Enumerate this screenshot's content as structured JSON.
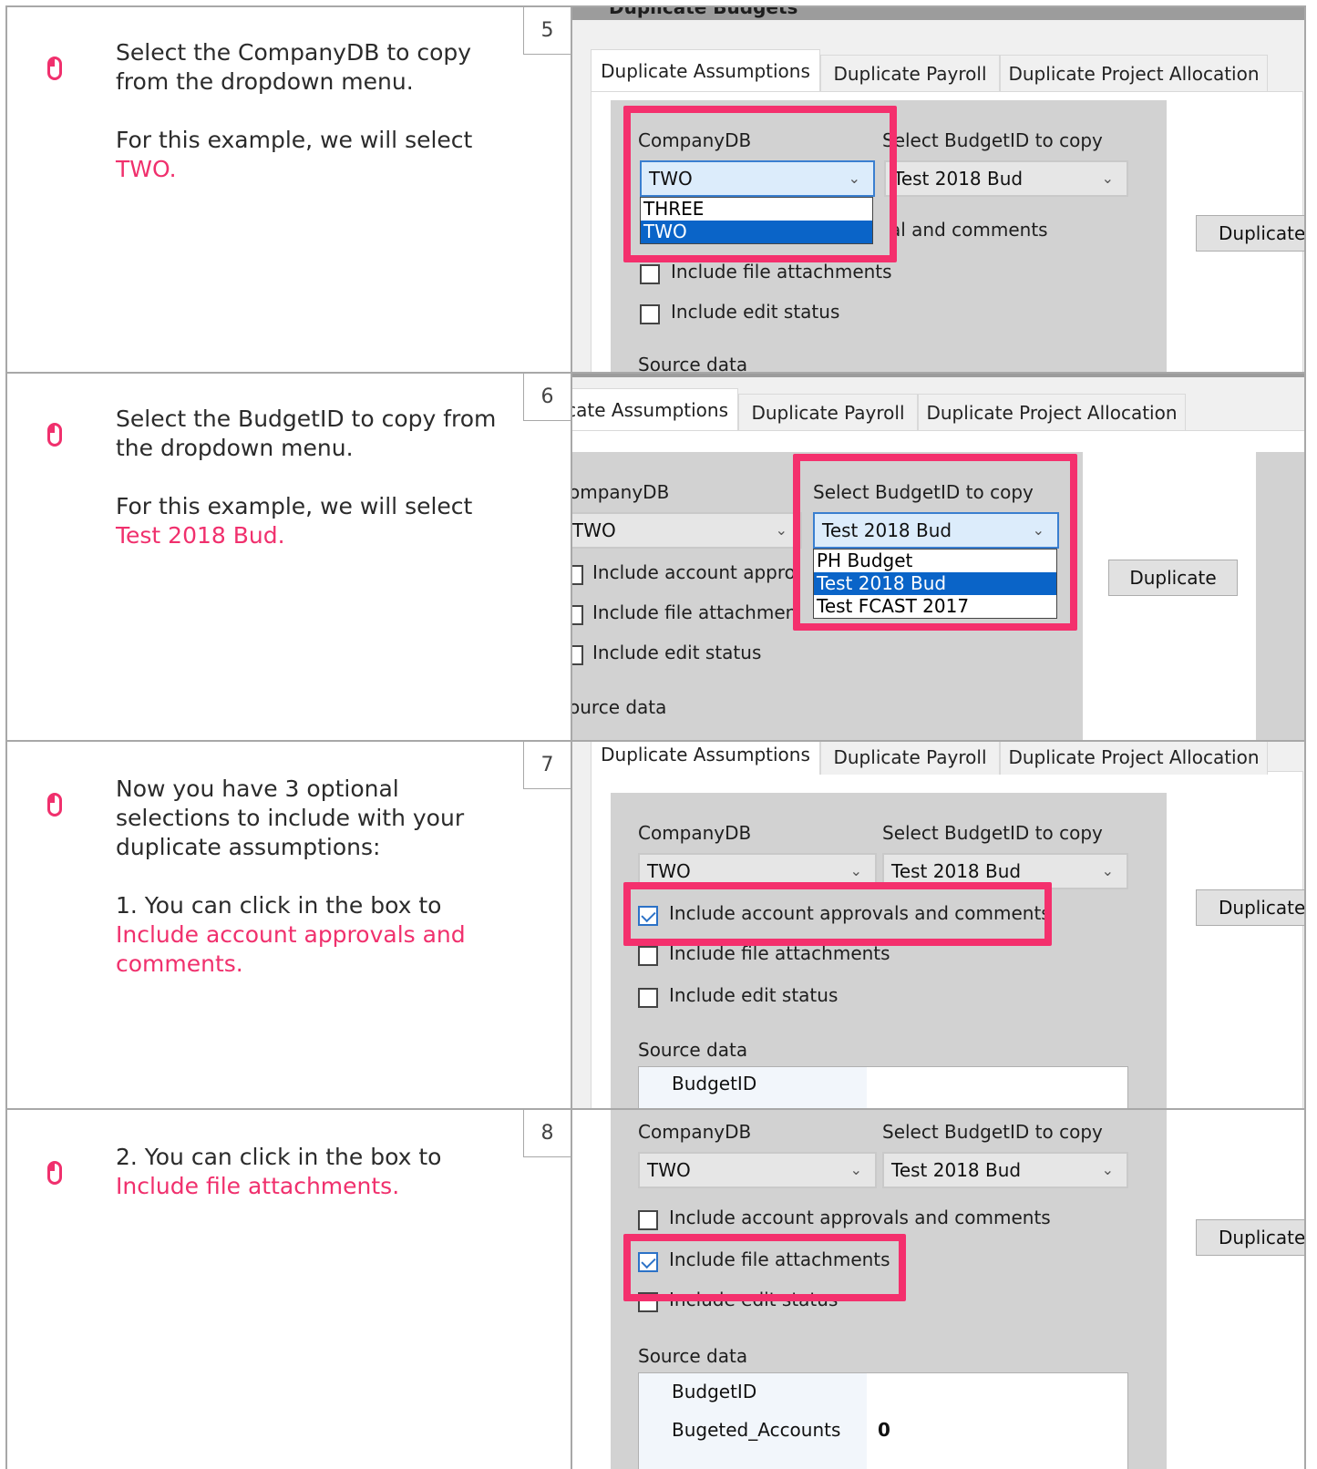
{
  "steps": [
    {
      "number": "5",
      "text1": "Select the CompanyDB to copy from the dropdown menu.",
      "text2_prefix": "For this example, we will select ",
      "text2_highlight": "TWO."
    },
    {
      "number": "6",
      "text1": "Select the BudgetID to copy from the dropdown menu.",
      "text2_prefix": "For this example, we will select ",
      "text2_highlight": "Test 2018 Bud."
    },
    {
      "number": "7",
      "text1": "Now you have 3 optional selections to include with your duplicate assumptions:",
      "text2_prefix": "1. You can click in the box to ",
      "text2_highlight": "Include account approvals and comments."
    },
    {
      "number": "8",
      "text1_prefix": "2. You can click in the box to ",
      "text1_highlight": "Include file attachments."
    }
  ],
  "ui": {
    "window_title": "Duplicate Budgets",
    "tabs": [
      "Duplicate Assumptions",
      "Duplicate Payroll",
      "Duplicate Project Allocation"
    ],
    "tab5_visible": "Duplicate Assumptions",
    "tab6_truncated": "icate Assumptions",
    "companydb_label": "CompanyDB",
    "companydb_label_trunc": "ompanyDB",
    "budget_label": "Select BudgetID to copy",
    "budget_label_trunc": "elect BudgetID to copy",
    "companydb_value": "TWO",
    "budget_value": "Test 2018 Bud",
    "budget_value_trunc": "est 2018 Bud",
    "companydb_options": [
      "THREE",
      "TWO"
    ],
    "budget_options": [
      "PH Budget",
      "Test 2018 Bud",
      "Test FCAST 2017"
    ],
    "chk_approvals": "Include account approvals and comments",
    "chk_approvals_partial": "Include account appro",
    "chk_approvals_tail": "al and comments",
    "chk_files": "Include file attachments",
    "chk_files_partial": "Include file attachmen",
    "chk_edit": "Include edit status",
    "duplicate_button": "Duplicate",
    "duplicate_button_trunc": "Duplicat",
    "source_data": "Source data",
    "source_data_trunc": "ource data",
    "grid_budgetid": "BudgetID",
    "grid_budgeted_accounts": "Bugeted_Accounts",
    "grid_budgeted_accounts_value": "0"
  },
  "colors": {
    "accent": "#f0306d",
    "highlight_box": "#f4306d",
    "selection": "#0a64c8"
  },
  "icons": {
    "step_icon": "mouse-icon"
  }
}
